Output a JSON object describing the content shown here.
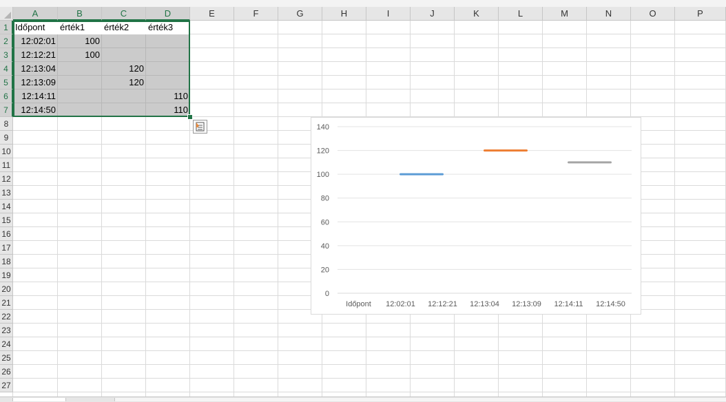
{
  "columns": [
    "A",
    "B",
    "C",
    "D",
    "E",
    "F",
    "G",
    "H",
    "I",
    "J",
    "K",
    "L",
    "M",
    "N",
    "O",
    "P"
  ],
  "rows": [
    "1",
    "2",
    "3",
    "4",
    "5",
    "6",
    "7",
    "8",
    "9",
    "10",
    "11",
    "12",
    "13",
    "14",
    "15",
    "16",
    "17",
    "18",
    "19",
    "20",
    "21",
    "22",
    "23",
    "24",
    "25",
    "26",
    "27"
  ],
  "sheet": {
    "headers": [
      "Időpont",
      "érték1",
      "érték2",
      "érték3"
    ],
    "data": [
      [
        "12:02:01",
        "100",
        "",
        ""
      ],
      [
        "12:12:21",
        "100",
        "",
        ""
      ],
      [
        "12:13:04",
        "",
        "120",
        ""
      ],
      [
        "12:13:09",
        "",
        "120",
        ""
      ],
      [
        "12:14:11",
        "",
        "",
        "110"
      ],
      [
        "12:14:50",
        "",
        "",
        "110"
      ]
    ]
  },
  "quick_analysis_icon": "quick-analysis-icon",
  "chart_data": {
    "type": "line",
    "categories": [
      "Időpont",
      "12:02:01",
      "12:12:21",
      "12:13:04",
      "12:13:09",
      "12:14:11",
      "12:14:50"
    ],
    "series": [
      {
        "values": [
          null,
          100,
          100,
          null,
          null,
          null,
          null
        ],
        "color": "#5b9bd5"
      },
      {
        "values": [
          null,
          null,
          null,
          120,
          120,
          null,
          null
        ],
        "color": "#ed7d31"
      },
      {
        "values": [
          null,
          null,
          null,
          null,
          null,
          110,
          110
        ],
        "color": "#a5a5a5"
      }
    ],
    "yticks": [
      0,
      20,
      40,
      60,
      80,
      100,
      120,
      140
    ],
    "ylim": [
      0,
      140
    ],
    "grid": true,
    "title": "",
    "xlabel": "",
    "ylabel": ""
  }
}
